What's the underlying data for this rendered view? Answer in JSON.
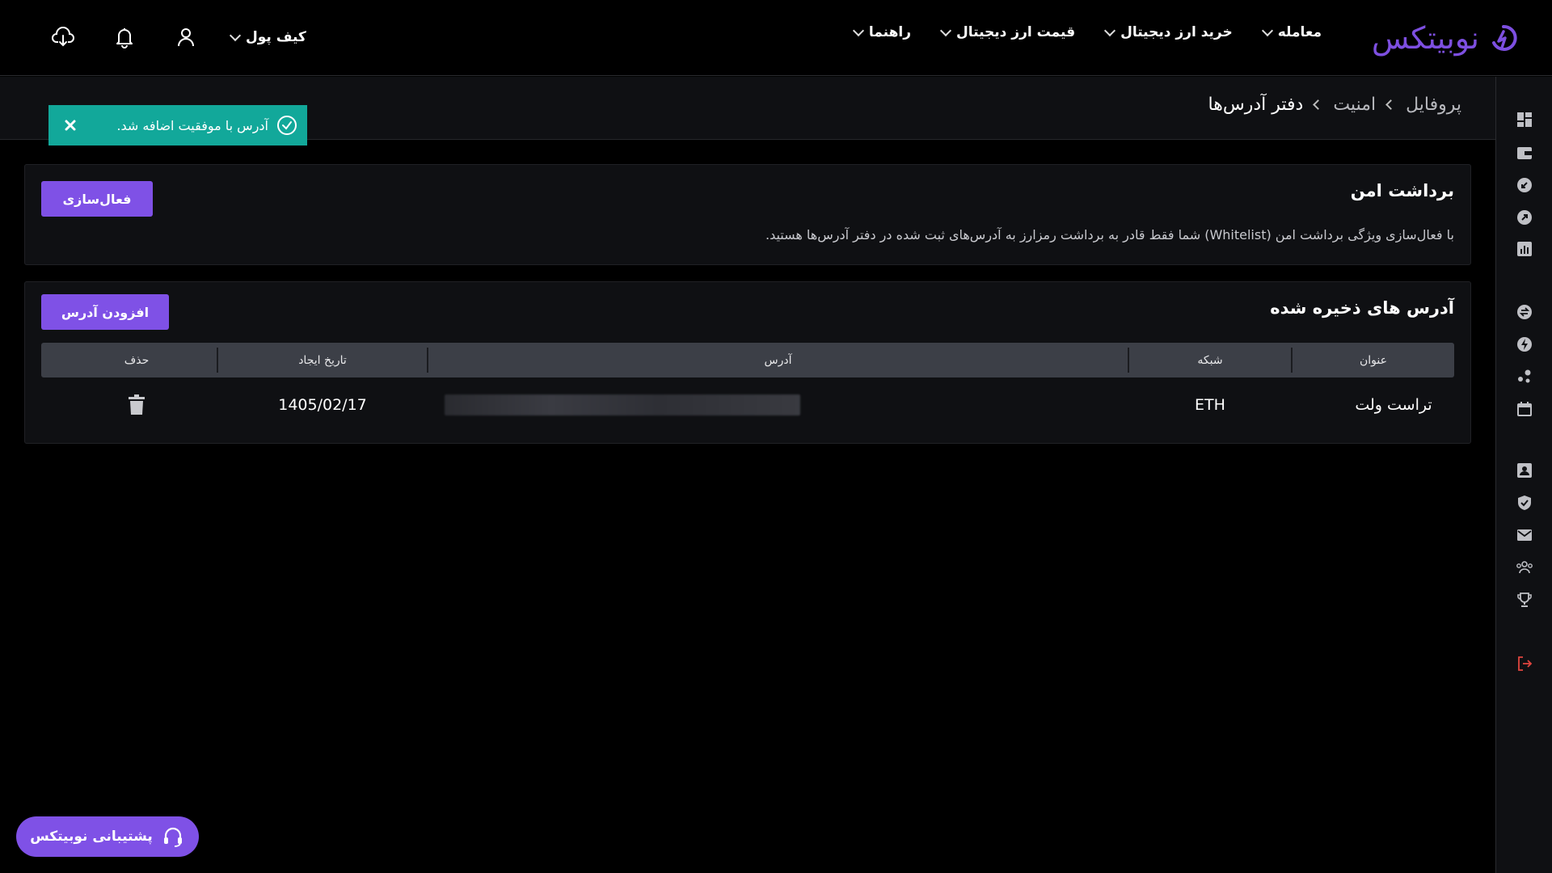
{
  "brand": {
    "logo_text": "نوبیتکس",
    "logo_color": "#7d4fe0"
  },
  "nav": {
    "items": [
      {
        "label": "معامله"
      },
      {
        "label": "خرید ارز دیجیتال"
      },
      {
        "label": "قیمت ارز دیجیتال"
      },
      {
        "label": "راهنما"
      }
    ]
  },
  "top_actions": {
    "wallet_label": "کیف پول",
    "icons": [
      "user-icon",
      "bell-icon",
      "download-icon"
    ]
  },
  "breadcrumb": {
    "items": [
      "پروفایل",
      "امنیت",
      "دفتر آدرس‌ها"
    ]
  },
  "toast": {
    "message": "آدرس با موفقیت اضافه شد.",
    "color": "#12a89a"
  },
  "secure_withdrawal": {
    "title": "برداشت امن",
    "description": "با فعال‌سازی ویژگی برداشت امن (Whitelist) شما فقط قادر به برداشت رمزارز به آدرس‌های ثبت شده در دفتر آدرس‌ها هستید.",
    "button_label": "فعال‌سازی"
  },
  "saved_addresses": {
    "title": "آدرس های ذخیره شده",
    "add_button_label": "افزودن آدرس",
    "columns": [
      "عنوان",
      "شبکه",
      "آدرس",
      "تاریخ ایجاد",
      "حذف"
    ],
    "rows": [
      {
        "title": "تراست ولت",
        "network": "ETH",
        "address": "",
        "created": "1405/02/17"
      }
    ]
  },
  "support": {
    "label": "پشتیبانی نوبیتکس"
  },
  "accent_color": "#7f51e6"
}
